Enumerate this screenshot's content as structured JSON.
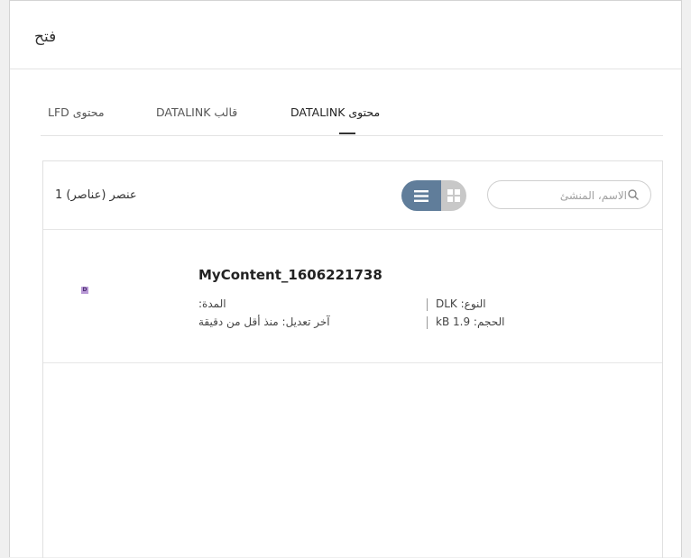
{
  "dialog": {
    "title": "فتح"
  },
  "tabs": [
    {
      "label": "LFD محتوى",
      "active": false
    },
    {
      "label": "DATALINK قالب",
      "active": false
    },
    {
      "label": "DATALINK محتوى",
      "active": true
    }
  ],
  "toolbar": {
    "item_count": "عنصر (عناصر) 1",
    "search_placeholder": "الاسم، المنشئ",
    "view_mode": "list"
  },
  "items": [
    {
      "name": "MyContent_1606221738",
      "thumb_label": "D",
      "type": "النوع: DLK",
      "size": "الحجم: 1.9 kB",
      "duration": "المدة:",
      "modified": "آخر تعديل: منذ أقل من دقيقة"
    }
  ],
  "colors": {
    "toggle_active": "#607d9a",
    "toggle_inactive": "#c8c8c8",
    "thumb": "#b99ad6"
  }
}
